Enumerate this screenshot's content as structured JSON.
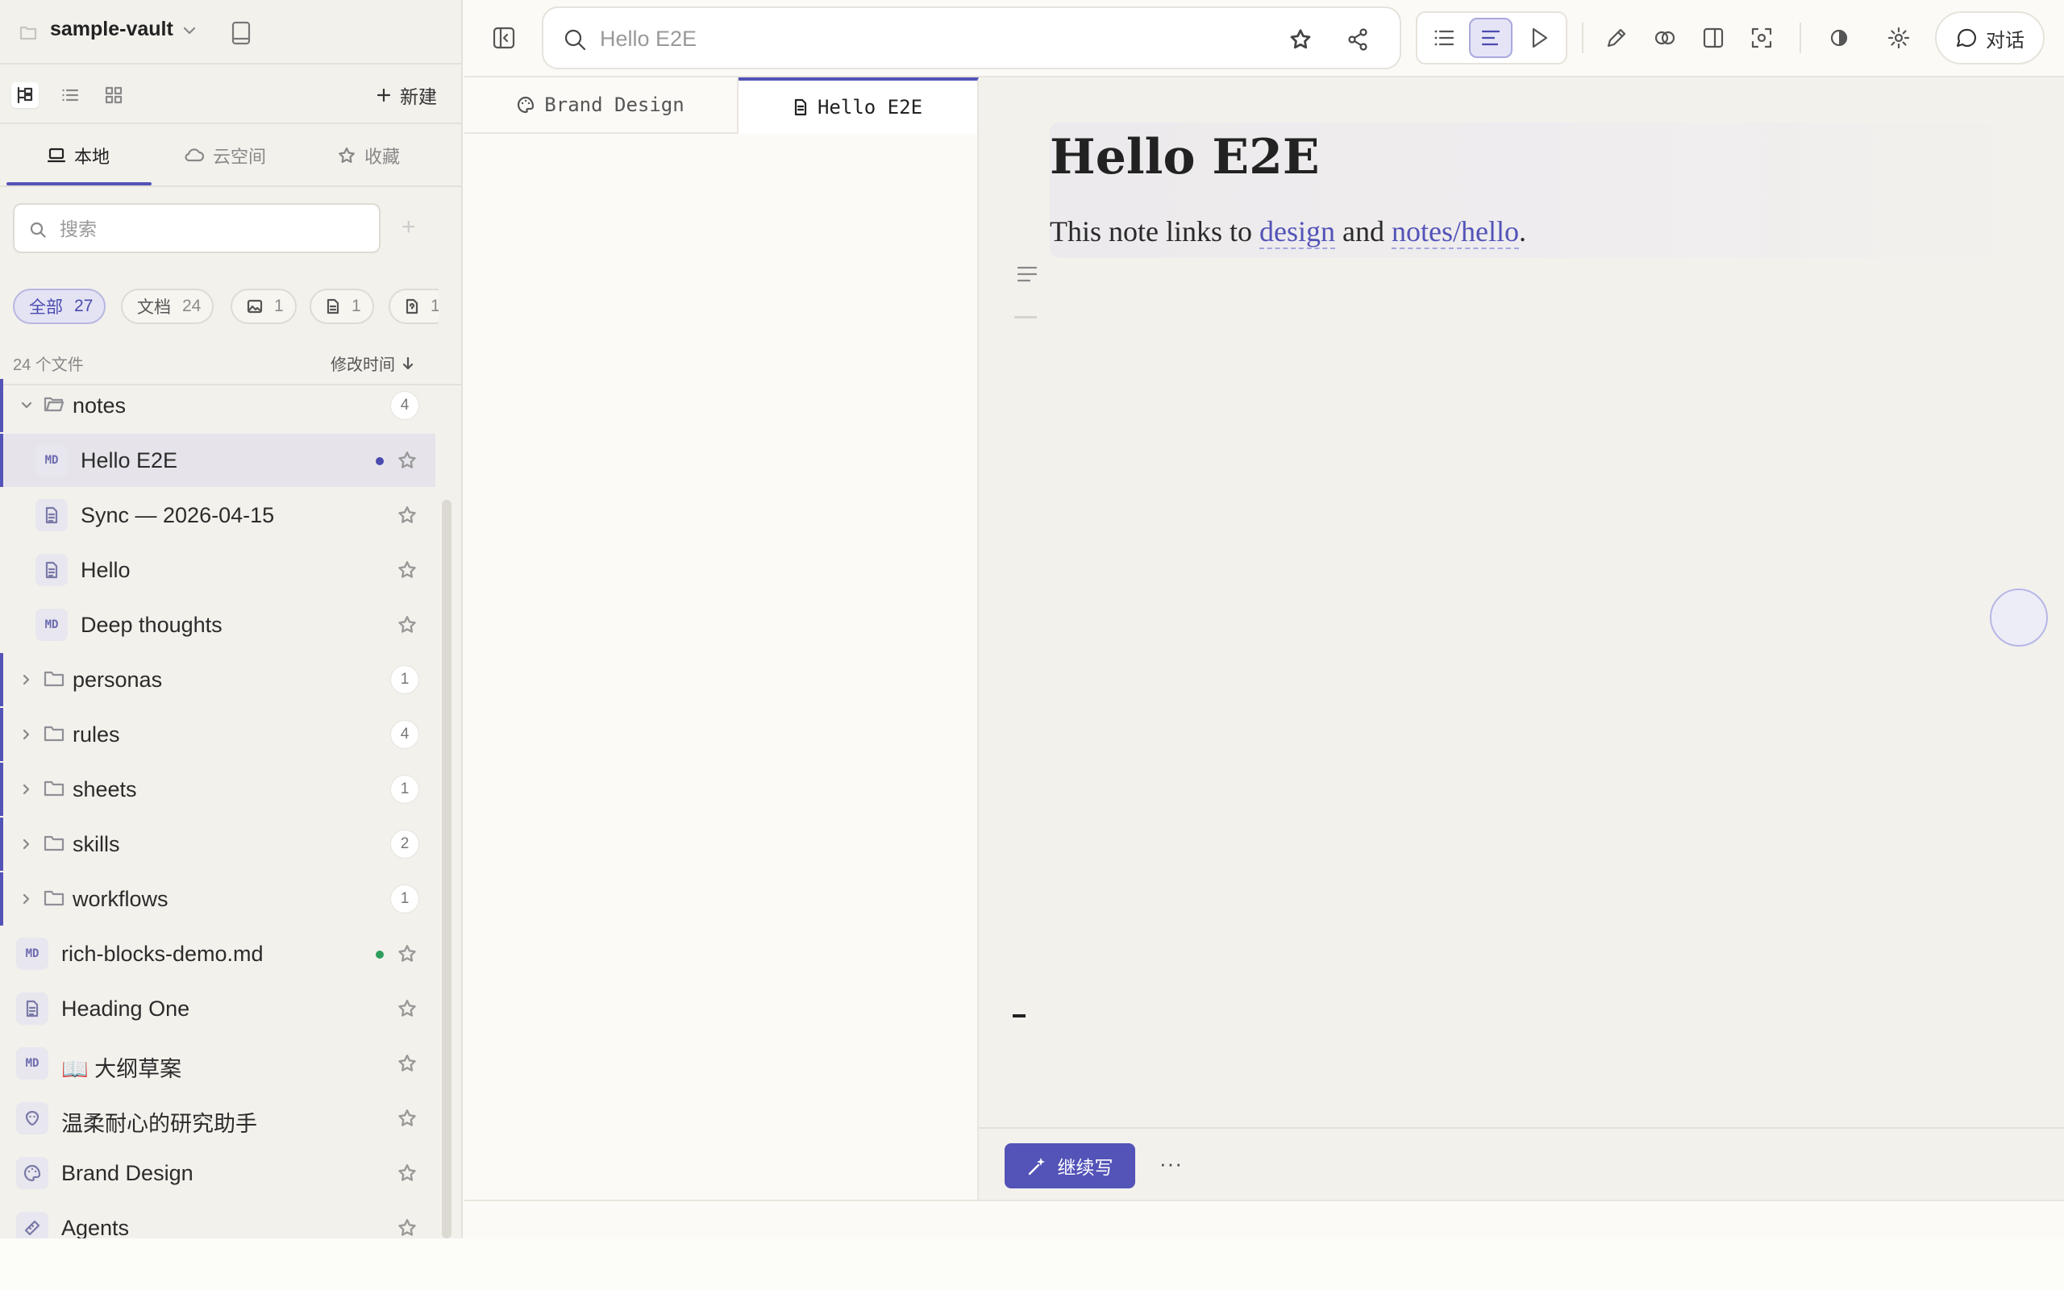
{
  "vault": {
    "name": "sample-vault"
  },
  "sidebar": {
    "new_label": "新建",
    "tabs": [
      {
        "label": "本地",
        "active": true
      },
      {
        "label": "云空间",
        "active": false
      },
      {
        "label": "收藏",
        "active": false
      }
    ],
    "search_placeholder": "搜索",
    "chips": [
      {
        "label": "全部",
        "count": "27",
        "active": true
      },
      {
        "label": "文档",
        "count": "24"
      },
      {
        "label": "",
        "count": "1",
        "icon": "image-icon"
      },
      {
        "label": "",
        "count": "1",
        "icon": "file-icon"
      },
      {
        "label": "",
        "count": "1",
        "icon": "file-unknown-icon"
      }
    ],
    "file_count": "24 个文件",
    "sort_label": "修改时间",
    "tree": {
      "notes": {
        "label": "notes",
        "count": "4"
      },
      "notes_children": [
        {
          "label": "Hello E2E",
          "type": "md",
          "selected": true,
          "dot_color": "#4a4ab0"
        },
        {
          "label": "Sync — 2026-04-15",
          "type": "doc"
        },
        {
          "label": "Hello",
          "type": "doc"
        },
        {
          "label": "Deep thoughts",
          "type": "md"
        }
      ],
      "folders": [
        {
          "label": "personas",
          "count": "1"
        },
        {
          "label": "rules",
          "count": "4"
        },
        {
          "label": "sheets",
          "count": "1"
        },
        {
          "label": "skills",
          "count": "2"
        },
        {
          "label": "workflows",
          "count": "1"
        }
      ],
      "files": [
        {
          "label": "rich-blocks-demo.md",
          "type": "md",
          "dot_color": "#2e9e5e"
        },
        {
          "label": "Heading One",
          "type": "doc"
        },
        {
          "label": "📖 大纲草案",
          "type": "md"
        },
        {
          "label": "温柔耐心的研究助手",
          "type": "persona"
        },
        {
          "label": "Brand Design",
          "type": "palette"
        },
        {
          "label": "Agents",
          "type": "rule"
        }
      ]
    }
  },
  "toolbar": {
    "search_placeholder": "Hello E2E",
    "chat_label": "对话"
  },
  "tabs": [
    {
      "label": "Brand Design",
      "icon": "palette-icon",
      "active": false
    },
    {
      "label": "Hello E2E",
      "icon": "document-icon",
      "active": true
    }
  ],
  "editor": {
    "title": "Hello E2E",
    "body_prefix": "This note links to ",
    "link1": "design",
    "body_mid": " and ",
    "link2": "notes/hello",
    "body_suffix": "."
  },
  "bottom": {
    "continue_label": "继续写",
    "more_label": "···"
  },
  "colors": {
    "accent": "#5353b8",
    "sidebar_bg": "#f3f1ec",
    "page_bg": "#fbfaf6"
  }
}
